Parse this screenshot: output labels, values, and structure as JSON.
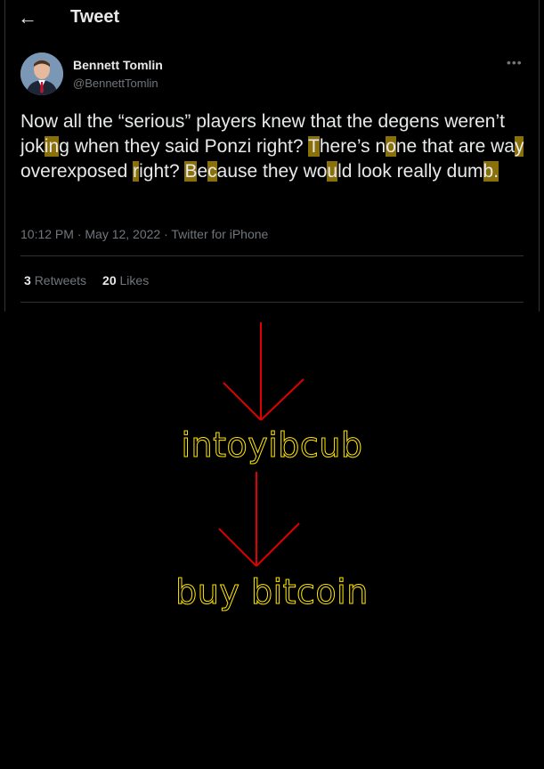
{
  "header": {
    "back_icon": "back-arrow-icon",
    "title": "Tweet"
  },
  "author": {
    "name": "Bennett Tomlin",
    "handle": "@BennettTomlin",
    "avatar": "avatar-photo"
  },
  "more_icon": "more-options-icon",
  "tweet": {
    "segments": [
      {
        "t": "Now all the “serious” players knew that the degens weren’t jok",
        "h": false
      },
      {
        "t": "in",
        "h": true
      },
      {
        "t": "g when they said Ponzi right? ",
        "h": false
      },
      {
        "t": "T",
        "h": true
      },
      {
        "t": "here’s n",
        "h": false
      },
      {
        "t": "o",
        "h": true
      },
      {
        "t": "ne that are wa",
        "h": false
      },
      {
        "t": "y",
        "h": true
      },
      {
        "t": " overexposed ",
        "h": false
      },
      {
        "t": "r",
        "h": true
      },
      {
        "t": "ight? ",
        "h": false
      },
      {
        "t": "B",
        "h": true
      },
      {
        "t": "e",
        "h": false
      },
      {
        "t": "c",
        "h": true
      },
      {
        "t": "ause they wo",
        "h": false
      },
      {
        "t": "u",
        "h": true
      },
      {
        "t": "ld look really dum",
        "h": false
      },
      {
        "t": "b.",
        "h": true
      }
    ],
    "highlight_color": "#8a7009"
  },
  "meta": "10:12 PM · May 12, 2022 · Twitter for iPhone",
  "stats": {
    "retweets_count": "3",
    "retweets_label": "Retweets",
    "likes_count": "20",
    "likes_label": "Likes"
  },
  "meme": {
    "hidden_letters": "intoyibcub",
    "decoded": "buy bitcoin",
    "arrow_color": "#e00000",
    "text_color": "#ffe600"
  }
}
